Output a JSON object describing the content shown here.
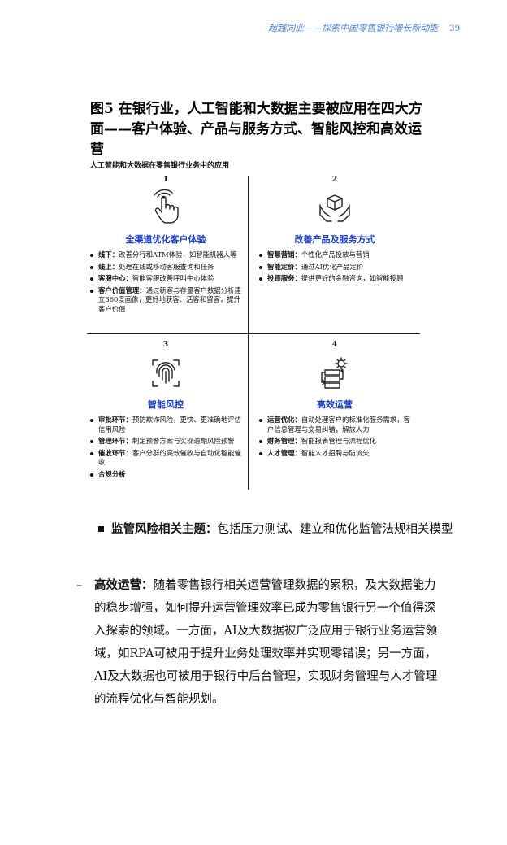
{
  "header": {
    "running_title": "超越同业——探索中国零售银行增长新动能",
    "page_number": "39"
  },
  "figure": {
    "title": "图5 在银行业，人工智能和大数据主要被应用在四大方面——客户体验、产品与服务方式、智能风控和高效运营",
    "subtitle": "人工智能和大数据在零售银行业务中的应用",
    "quadrants": [
      {
        "number": "1",
        "icon": "hand-touch-icon",
        "title": "全渠道优化客户体验",
        "items": [
          {
            "label": "线下：",
            "text": "改善分行和ATM体验，如智能机器人等"
          },
          {
            "label": "线上：",
            "text": "处理在线或移动客服查询和任务"
          },
          {
            "label": "客服中心：",
            "text": "智能客服改善呼叫中心体验"
          },
          {
            "label": "客户价值管理：",
            "text": "通过新客与存量客户数据分析建立360度画像，更好地获客、活客和留客，提升客户价值"
          }
        ]
      },
      {
        "number": "2",
        "icon": "hands-box-icon",
        "title": "改善产品及服务方式",
        "items": [
          {
            "label": "智慧营销：",
            "text": "个性化产品投放与营销"
          },
          {
            "label": "智能定价：",
            "text": "通过AI优化产品定价"
          },
          {
            "label": "投顾服务：",
            "text": "提供更好的金融咨询，如智能投顾"
          }
        ]
      },
      {
        "number": "3",
        "icon": "fingerprint-scan-icon",
        "title": "智能风控",
        "items": [
          {
            "label": "审批环节：",
            "text": "预防欺诈风险，更快、更准确地评估信用风险"
          },
          {
            "label": "管理环节：",
            "text": "制定预警方案与实现逾期风险预警"
          },
          {
            "label": "催收环节：",
            "text": "客户分群的高效催收与自动化智能催收"
          },
          {
            "label": "合规分析",
            "text": ""
          }
        ]
      },
      {
        "number": "4",
        "icon": "gear-workflow-icon",
        "title": "高效运营",
        "items": [
          {
            "label": "运营优化：",
            "text": "自动处理客户的标准化服务需求，客户信息管理与交易纠错，解放人力"
          },
          {
            "label": "财务管理：",
            "text": "智能报表管理与流程优化"
          },
          {
            "label": "人才管理：",
            "text": "智能人才招聘与防流失"
          }
        ]
      }
    ]
  },
  "body": {
    "bullet": {
      "label": "监管风险相关主题：",
      "text": "包括压力测试、建立和优化监管法规相关模型"
    },
    "dash": {
      "mark": "–",
      "label": "高效运营：",
      "text": "随着零售银行相关运营管理数据的累积，及大数据能力的稳步增强，如何提升运营管理效率已成为零售银行另一个值得深入探索的领域。一方面，AI及大数据被广泛应用于银行业务运营领域，如RPA可被用于提升业务处理效率并实现零错误；另一方面，AI及大数据也可被用于银行中后台管理，实现财务管理与人才管理的流程优化与智能规划。"
    }
  }
}
